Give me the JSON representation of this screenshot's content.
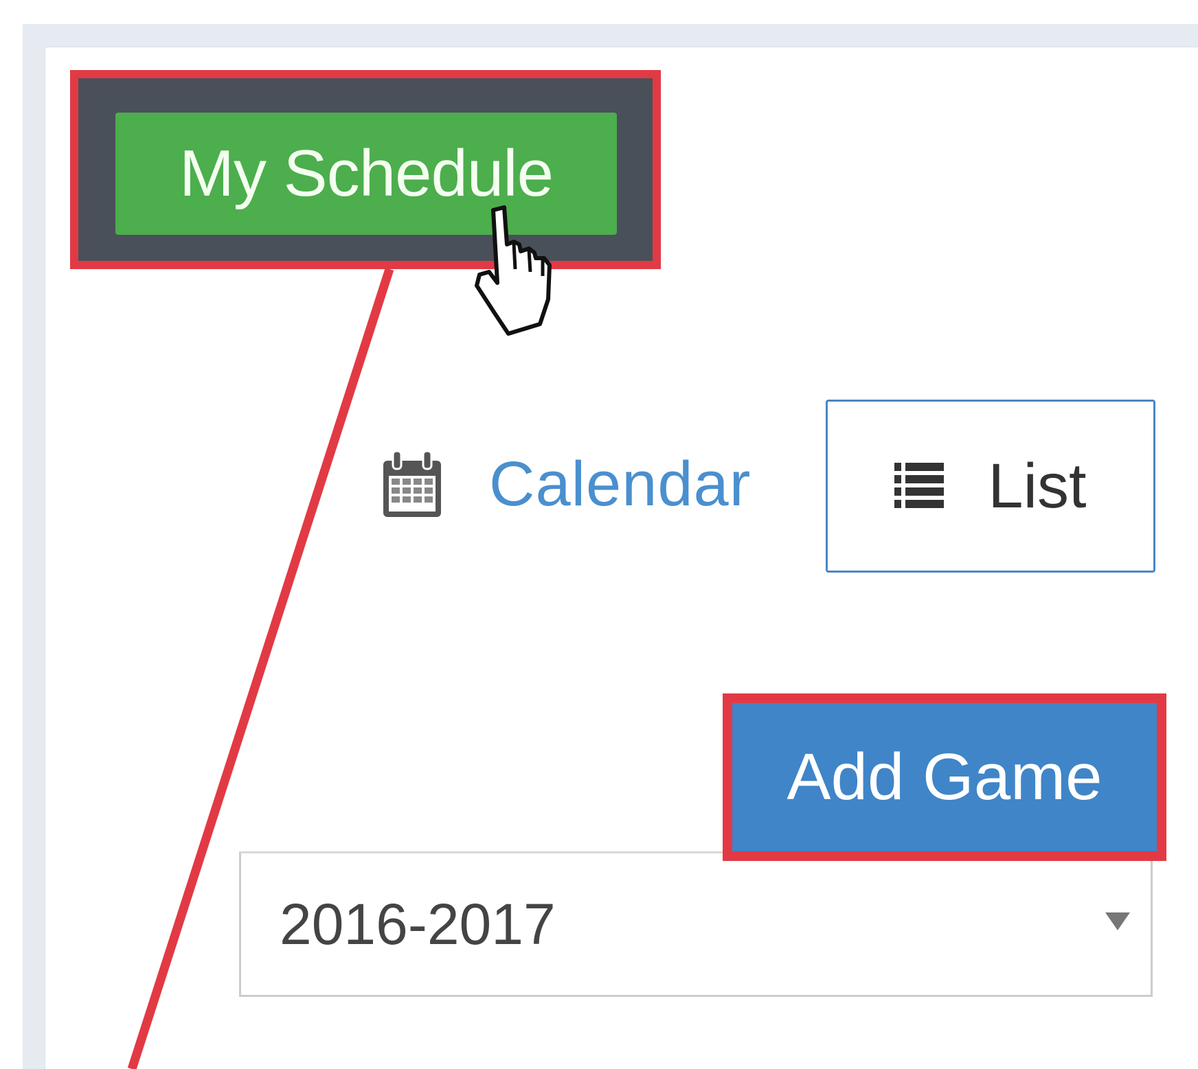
{
  "header": {
    "my_schedule_label": "My Schedule"
  },
  "view_toggle": {
    "calendar_label": "Calendar",
    "calendar_icon": "calendar-icon",
    "list_label": "List",
    "list_icon": "list-icon"
  },
  "actions": {
    "add_game_label": "Add Game"
  },
  "season_select": {
    "selected": "2016-2017"
  },
  "colors": {
    "green_button": "#4cae4c",
    "blue_button": "#3f85c8",
    "callout_red": "#e23a44",
    "link_blue": "#4a8fcf"
  }
}
